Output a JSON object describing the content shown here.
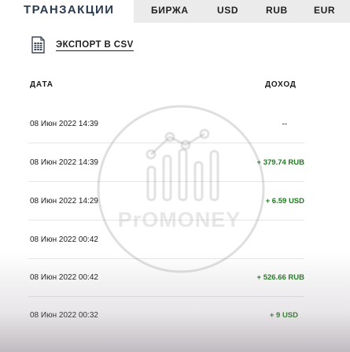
{
  "tabs": {
    "active": "ТРАНЗАКЦИИ",
    "birzha": "БИРЖА",
    "usd": "USD",
    "rub": "RUB",
    "eur": "EUR"
  },
  "export": {
    "label": "ЭКСПОРТ В CSV",
    "icon": "spreadsheet-icon"
  },
  "table": {
    "headers": {
      "date": "ДАТА",
      "income": "ДОХОД"
    },
    "rows": [
      {
        "date": "08 Июн 2022 14:39",
        "amount": "--"
      },
      {
        "date": "08 Июн 2022 14:39",
        "amount": "+ 379.74 RUB"
      },
      {
        "date": "08 Июн 2022 14:29",
        "amount": "+ 6.59 USD"
      },
      {
        "date": "08 Июн 2022 00:42",
        "amount": ""
      },
      {
        "date": "08 Июн 2022 00:42",
        "amount": "+ 526.66 RUB"
      },
      {
        "date": "08 Июн 2022 00:32",
        "amount": "+ 9 USD"
      }
    ]
  },
  "watermark": {
    "text": "PrOMONEY"
  },
  "colors": {
    "accent": "#2a3b4f",
    "income": "#1f7a1f",
    "tab_bg": "#ebebeb"
  }
}
